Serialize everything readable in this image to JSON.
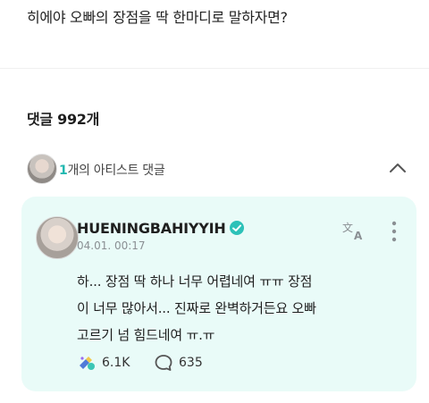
{
  "post": {
    "text": "히에야 오빠의 장점을 딱 한마디로 말하자면?"
  },
  "comments": {
    "count_label": "댓글 992개",
    "artist_bar": {
      "count": "1",
      "label": "개의 아티스트 댓글"
    }
  },
  "artist_comment": {
    "author": "HUENINGBAHIYYIH",
    "timestamp": "04.01. 00:17",
    "body": "하... 장점 딱 하나 너무 어렵네여 ㅠㅠ  장점\n이 너무 많아서... 진짜로 완벽하거든요 오빠\n고르기 넘 힘드네여 ㅠ.ㅠ",
    "likes": "6.1K",
    "replies": "635"
  },
  "icons": {
    "verified": "verified-badge-icon",
    "translate": "translate-icon",
    "more": "more-vertical-icon",
    "like": "cheer-like-icon",
    "reply": "comment-bubble-icon",
    "collapse": "chevron-up-icon"
  },
  "colors": {
    "accent": "#22b8b0",
    "card_bg": "#e9fbf8"
  }
}
